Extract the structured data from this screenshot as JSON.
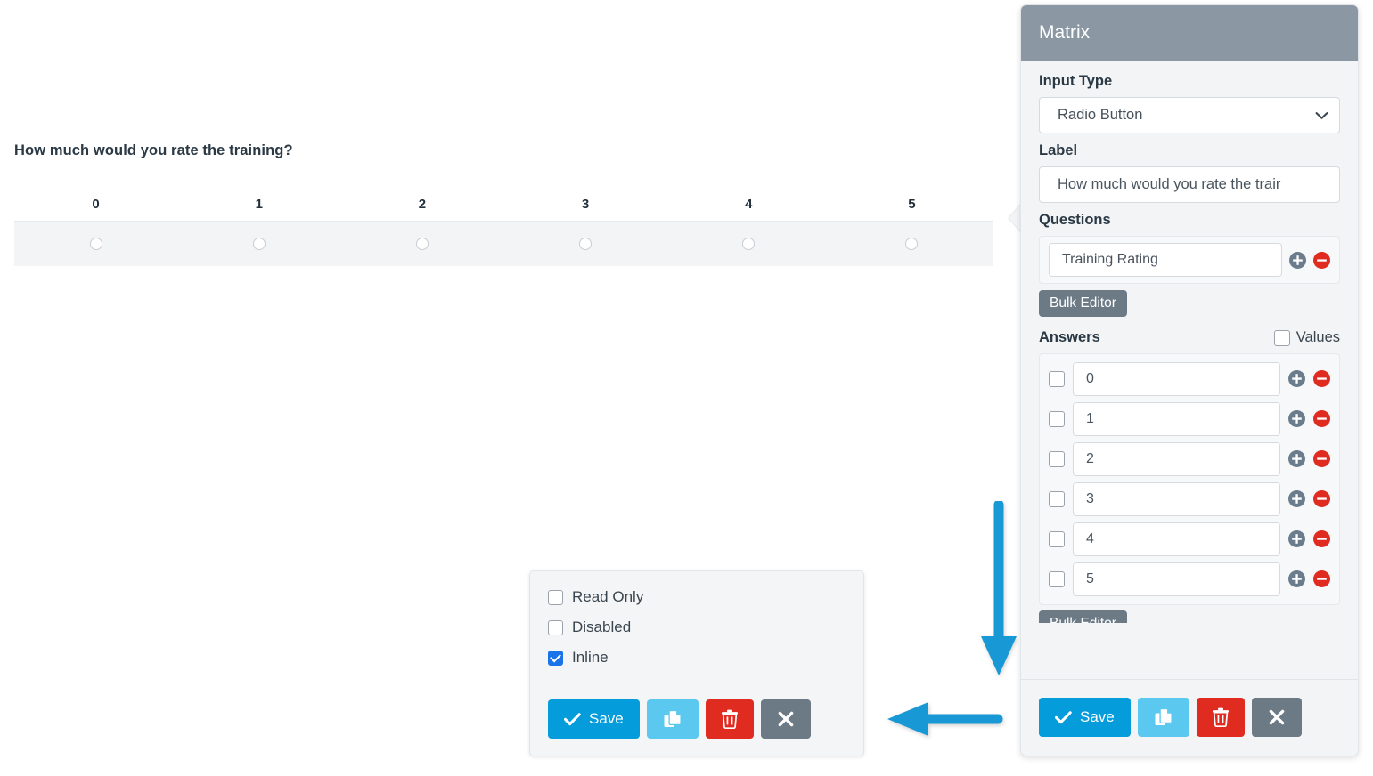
{
  "preview": {
    "question_title": "How much would you rate the training?",
    "columns": [
      "0",
      "1",
      "2",
      "3",
      "4",
      "5"
    ],
    "input_type": "radio"
  },
  "option_card": {
    "checkboxes": [
      {
        "label": "Read Only",
        "checked": false
      },
      {
        "label": "Disabled",
        "checked": false
      },
      {
        "label": "Inline",
        "checked": true
      }
    ],
    "buttons": {
      "save_label": "Save",
      "copy_icon": "copy-icon",
      "delete_icon": "trash-icon",
      "close_icon": "close-icon"
    }
  },
  "panel": {
    "title": "Matrix",
    "input_type": {
      "label": "Input Type",
      "value": "Radio Button"
    },
    "label_field": {
      "label": "Label",
      "value": "How much would you rate the trair"
    },
    "questions": {
      "label": "Questions",
      "rows": [
        {
          "value": "Training Rating"
        }
      ],
      "bulk_editor_label": "Bulk Editor"
    },
    "answers": {
      "label": "Answers",
      "values_label": "Values",
      "values_checked": false,
      "bulk_editor_label": "Bulk Editor",
      "rows": [
        {
          "value": "0",
          "checked": false
        },
        {
          "value": "1",
          "checked": false
        },
        {
          "value": "2",
          "checked": false
        },
        {
          "value": "3",
          "checked": false
        },
        {
          "value": "4",
          "checked": false
        },
        {
          "value": "5",
          "checked": false
        }
      ]
    },
    "buttons": {
      "save_label": "Save",
      "copy_icon": "copy-icon",
      "delete_icon": "trash-icon",
      "close_icon": "close-icon"
    }
  },
  "annotations": {
    "arrow_down": "down-arrow",
    "arrow_left": "left-arrow",
    "color": "#1899d6"
  },
  "colors": {
    "header": "#8b97a3",
    "save": "#049cdb",
    "copy": "#5bc8ef",
    "delete": "#e02b20",
    "close": "#6c7a86",
    "accent_check": "#1a73e8",
    "arrow": "#1899d6"
  }
}
